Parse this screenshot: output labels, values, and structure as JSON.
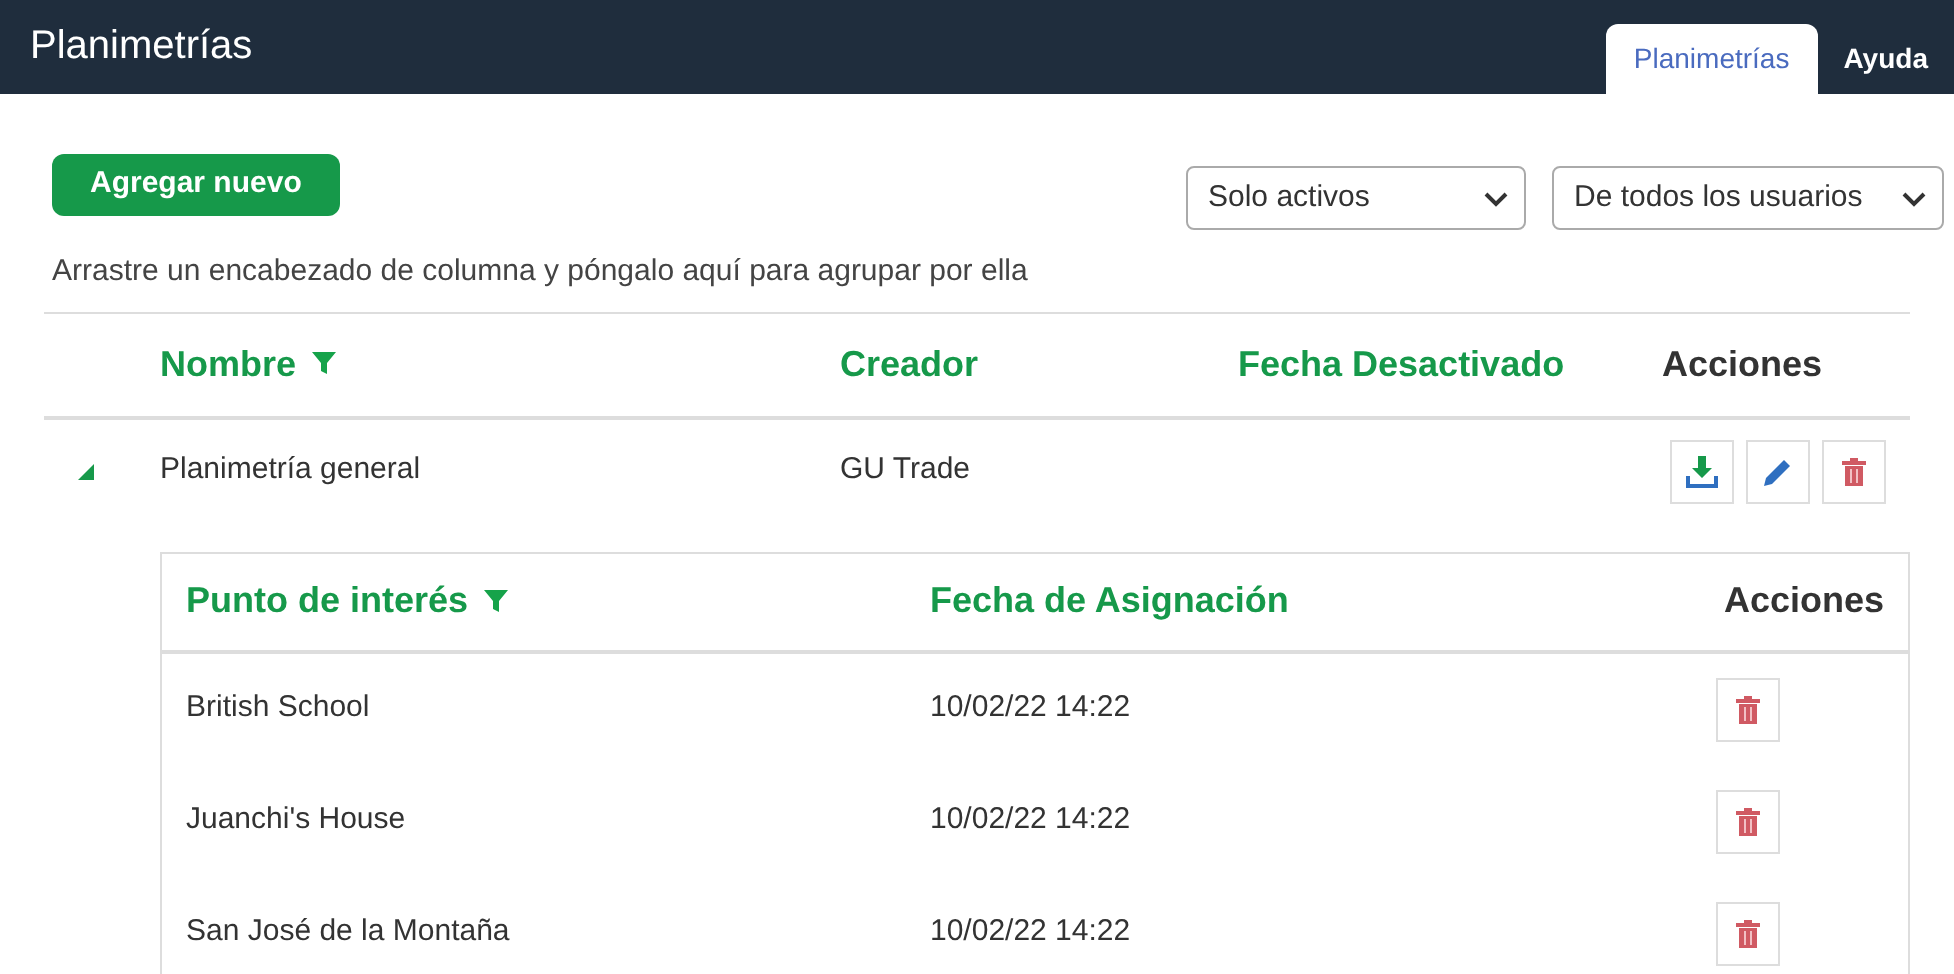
{
  "header": {
    "title": "Planimetrías",
    "tabs": [
      {
        "label": "Planimetrías",
        "selected": true
      },
      {
        "label": "Ayuda",
        "selected": false
      }
    ]
  },
  "toolbar": {
    "add_button": "Agregar nuevo",
    "filters": [
      {
        "value": "Solo activos"
      },
      {
        "value": "De todos los usuarios"
      }
    ],
    "group_hint": "Arrastre un encabezado de columna y póngalo aquí para agrupar por ella"
  },
  "table": {
    "columns": [
      {
        "label": "Nombre",
        "filter": true
      },
      {
        "label": "Creador",
        "filter": false
      },
      {
        "label": "Fecha Desactivado",
        "filter": false
      },
      {
        "label": "Acciones",
        "filter": false
      }
    ],
    "rows": [
      {
        "expanded": true,
        "nombre": "Planimetría general",
        "creador": "GU Trade",
        "fecha_desactivado": "",
        "detail": {
          "columns": [
            {
              "label": "Punto de interés",
              "filter": true
            },
            {
              "label": "Fecha de Asignación",
              "filter": false
            },
            {
              "label": "Acciones",
              "filter": false
            }
          ],
          "rows": [
            {
              "punto": "British School",
              "fecha": "10/02/22 14:22"
            },
            {
              "punto": "Juanchi's House",
              "fecha": "10/02/22 14:22"
            },
            {
              "punto": "San José de la Montaña",
              "fecha": "10/02/22 14:22"
            }
          ]
        }
      }
    ]
  }
}
